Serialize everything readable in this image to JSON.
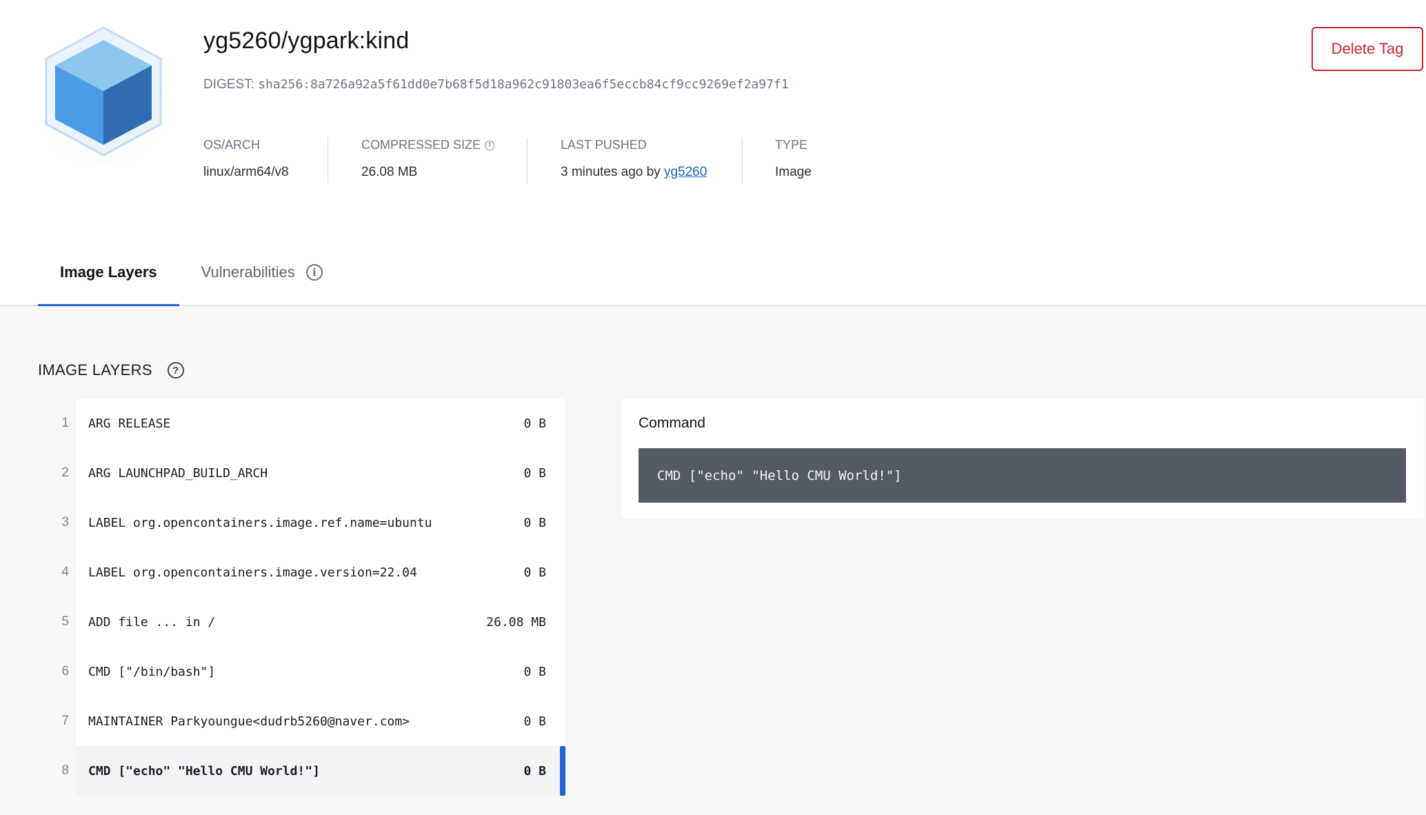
{
  "tag": {
    "title": "yg5260/ygpark:kind",
    "digest_label": "DIGEST:",
    "digest_value": "sha256:8a726a92a5f61dd0e7b68f5d18a962c91803ea6f5eccb84cf9cc9269ef2a97f1",
    "delete_label": "Delete Tag"
  },
  "meta": {
    "os_arch": {
      "label": "OS/ARCH",
      "value": "linux/arm64/v8"
    },
    "compressed_size": {
      "label": "COMPRESSED SIZE",
      "value": "26.08 MB"
    },
    "last_pushed": {
      "label": "LAST PUSHED",
      "prefix": "3 minutes ago by",
      "user": "yg5260"
    },
    "type": {
      "label": "TYPE",
      "value": "Image"
    }
  },
  "tabs": [
    {
      "label": "Image Layers",
      "active": true
    },
    {
      "label": "Vulnerabilities",
      "active": false
    }
  ],
  "section": {
    "title": "IMAGE LAYERS"
  },
  "layers": [
    {
      "num": "1",
      "cmd": "ARG RELEASE",
      "size": "0 B"
    },
    {
      "num": "2",
      "cmd": "ARG LAUNCHPAD_BUILD_ARCH",
      "size": "0 B"
    },
    {
      "num": "3",
      "cmd": "LABEL org.opencontainers.image.ref.name=ubuntu",
      "size": "0 B"
    },
    {
      "num": "4",
      "cmd": "LABEL org.opencontainers.image.version=22.04",
      "size": "0 B"
    },
    {
      "num": "5",
      "cmd": "ADD file ... in /",
      "size": "26.08 MB"
    },
    {
      "num": "6",
      "cmd": "CMD [\"/bin/bash\"]",
      "size": "0 B"
    },
    {
      "num": "7",
      "cmd": "MAINTAINER Parkyoungue<dudrb5260@naver.com>",
      "size": "0 B"
    },
    {
      "num": "8",
      "cmd": "CMD [\"echo\" \"Hello CMU World!\"]",
      "size": "0 B",
      "selected": true
    }
  ],
  "command_panel": {
    "title": "Command",
    "value": "CMD [\"echo\" \"Hello CMU World!\"]"
  },
  "colors": {
    "accent": "#1f63d0",
    "danger": "#c8252c",
    "command_bg": "#535a66"
  },
  "icons": {
    "logo": "image-cube-icon",
    "size_info": "info-icon",
    "vuln_info": "info-icon",
    "section_help": "help-icon"
  }
}
